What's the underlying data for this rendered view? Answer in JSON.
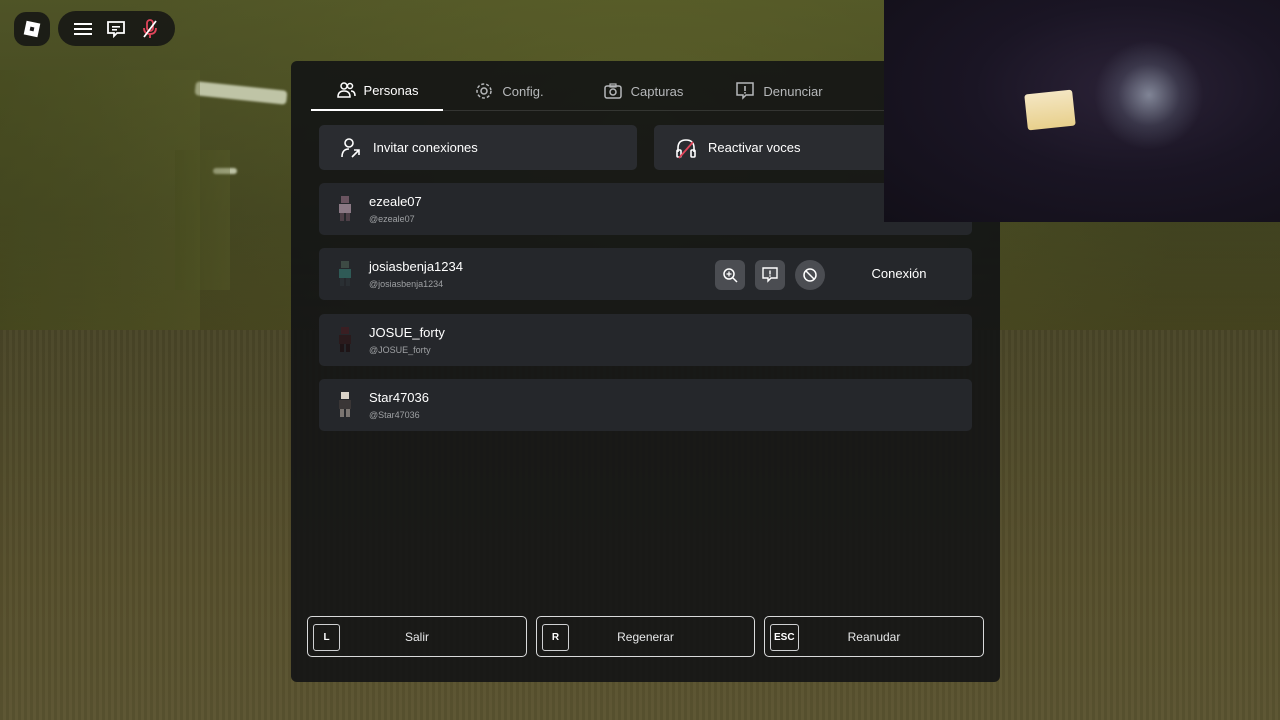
{
  "tabs": [
    {
      "label": "Personas",
      "icon": "people-icon",
      "active": true
    },
    {
      "label": "Config.",
      "icon": "gear-icon",
      "active": false
    },
    {
      "label": "Capturas",
      "icon": "camera-icon",
      "active": false
    },
    {
      "label": "Denunciar",
      "icon": "report-icon",
      "active": false
    }
  ],
  "actions": {
    "invite_label": "Invitar conexiones",
    "unmute_label": "Reactivar voces"
  },
  "players": [
    {
      "name": "ezeale07",
      "handle": "@ezeale07"
    },
    {
      "name": "josiasbenja1234",
      "handle": "@josiasbenja1234",
      "connect_label": "Conexión"
    },
    {
      "name": "JOSUE_forty",
      "handle": "@JOSUE_forty"
    },
    {
      "name": "Star47036",
      "handle": "@Star47036"
    }
  ],
  "bottom": {
    "leave": {
      "key": "L",
      "label": "Salir"
    },
    "reset": {
      "key": "R",
      "label": "Regenerar"
    },
    "resume": {
      "key": "ESC",
      "label": "Reanudar"
    }
  },
  "colors": {
    "panel": "#111214",
    "row": "#25272b",
    "mic_muted": "#e0455a"
  }
}
